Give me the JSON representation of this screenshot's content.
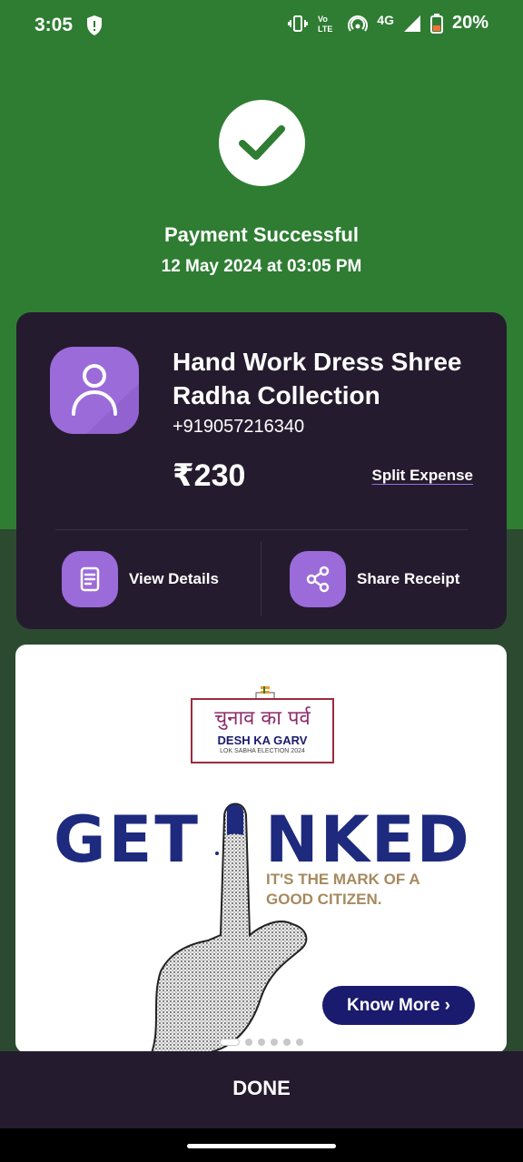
{
  "status_bar": {
    "time": "3:05",
    "network": "4G",
    "volte": "Vo LTE",
    "battery": "20%"
  },
  "payment": {
    "status": "Payment Successful",
    "datetime": "12 May 2024 at 03:05 PM"
  },
  "merchant": {
    "name": "Hand Work Dress Shree Radha Collection",
    "phone": "+919057216340",
    "amount": "₹230",
    "split_label": "Split Expense"
  },
  "actions": {
    "view_details": "View Details",
    "share_receipt": "Share Receipt"
  },
  "banner": {
    "logo_hindi": "चुनाव का पर्व",
    "logo_english": "DESH KA GARV",
    "logo_sub": "LOK SABHA ELECTION 2024",
    "headline_left": "GET",
    "headline_right": "NKED",
    "tagline": "IT'S THE MARK OF A GOOD CITIZEN.",
    "cta": "Know More ›",
    "carousel_total": 6,
    "carousel_active": 1
  },
  "footer": {
    "done_label": "DONE"
  },
  "colors": {
    "success_green": "#2e7d32",
    "card_bg": "#241b2e",
    "accent_purple": "#9b6bd9",
    "banner_navy": "#1d2a7e"
  }
}
